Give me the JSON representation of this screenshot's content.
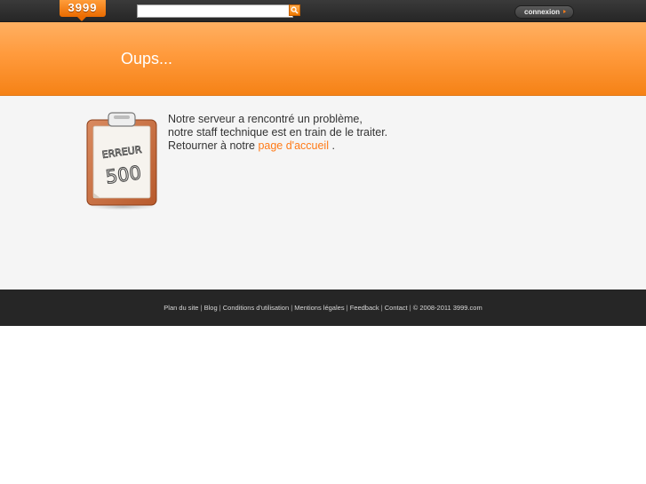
{
  "header": {
    "logo_text": "3999",
    "search": {
      "value": "",
      "placeholder": ""
    },
    "connexion_label": "connexion",
    "icons": {
      "search": "search-icon",
      "connexion_arrow": "triangle-right-icon"
    },
    "colors": {
      "accent": "#ff8a1f",
      "topbar": "#2e2e2e"
    }
  },
  "banner": {
    "title": "Oups..."
  },
  "error": {
    "badge_line1": "ERREUR",
    "badge_line2": "500",
    "line1": "Notre serveur a rencontré un problème,",
    "line2": "notre staff technique est en train de le traiter.",
    "line3_prefix": "Retourner à notre ",
    "home_link": "page d'accueil",
    "line3_suffix": " ."
  },
  "footer": {
    "links": [
      "Plan du site",
      "Blog",
      "Conditions d'utilisation",
      "Mentions légales",
      "Feedback",
      "Contact"
    ],
    "separator": " | ",
    "copyright": "© 2008-2011 3999.com"
  }
}
